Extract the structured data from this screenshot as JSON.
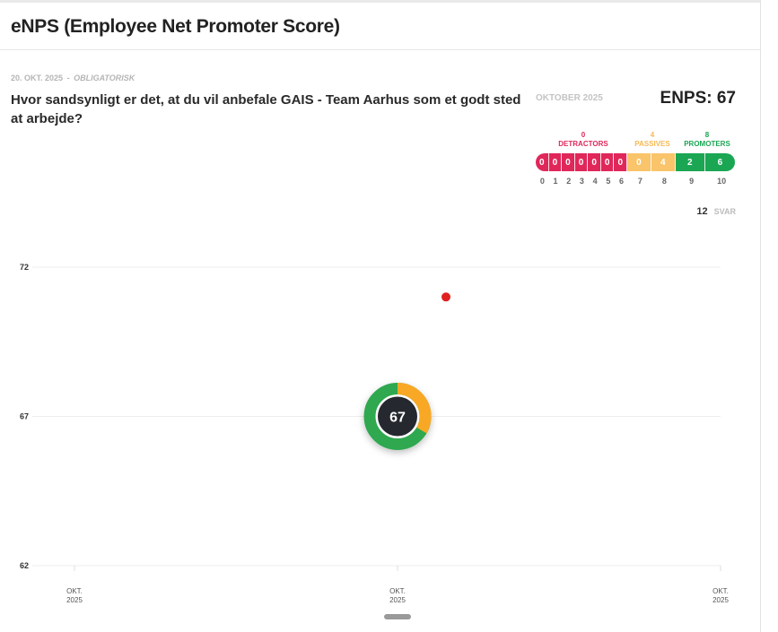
{
  "header": {
    "title": "eNPS (Employee Net Promoter Score)"
  },
  "meta": {
    "date": "20. OKT. 2025",
    "separator": "-",
    "tag": "OBLIGATORISK"
  },
  "question": "Hvor sandsynligt er det, at du vil anbefale GAIS - Team Aarhus som et godt sted at arbejde?",
  "summary": {
    "period": "OKTOBER 2025",
    "enps_label": "ENPS: 67"
  },
  "groups": {
    "detractors": {
      "count": "0",
      "label": "DETRACTORS",
      "color": "#e0275a"
    },
    "passives": {
      "count": "4",
      "label": "PASSIVES",
      "color": "#f7b955"
    },
    "promoters": {
      "count": "8",
      "label": "PROMOTERS",
      "color": "#1aa653"
    }
  },
  "scale": [
    {
      "score": "0",
      "count": "0",
      "group": "det"
    },
    {
      "score": "1",
      "count": "0",
      "group": "det"
    },
    {
      "score": "2",
      "count": "0",
      "group": "det"
    },
    {
      "score": "3",
      "count": "0",
      "group": "det"
    },
    {
      "score": "4",
      "count": "0",
      "group": "det"
    },
    {
      "score": "5",
      "count": "0",
      "group": "det"
    },
    {
      "score": "6",
      "count": "0",
      "group": "det"
    },
    {
      "score": "7",
      "count": "0",
      "group": "pas"
    },
    {
      "score": "8",
      "count": "4",
      "group": "pas"
    },
    {
      "score": "9",
      "count": "2",
      "group": "pro"
    },
    {
      "score": "10",
      "count": "6",
      "group": "pro"
    }
  ],
  "responses": {
    "count": "12",
    "label": "SVAR"
  },
  "chart_data": {
    "type": "line",
    "y_ticks": [
      72,
      67,
      62
    ],
    "ylim": [
      62,
      72
    ],
    "x_ticks": [
      {
        "line1": "OKT.",
        "line2": "2025"
      },
      {
        "line1": "OKT.",
        "line2": "2025"
      },
      {
        "line1": "OKT.",
        "line2": "2025"
      }
    ],
    "points": [
      {
        "x_index": 1,
        "y": 67,
        "label": "67"
      }
    ],
    "marker_point": {
      "x_index": 1.15,
      "y": 71
    },
    "donut": {
      "promoters_fraction": 0.6667,
      "passives_fraction": 0.3333
    },
    "colors": {
      "promoters": "#2fa84f",
      "passives": "#f9a825",
      "center": "#25282e",
      "marker": "#e02020",
      "grid": "#ededed"
    }
  }
}
